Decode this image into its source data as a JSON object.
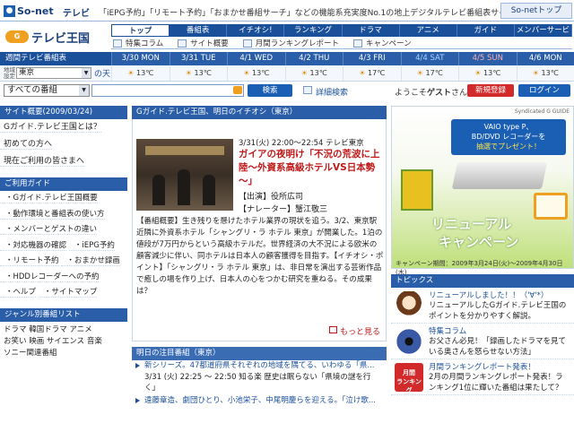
{
  "topbar": {
    "logo": "So-net",
    "tv": "テレビ",
    "tagline": "「iEPG予約」「リモート予約」「おまかせ番組サーチ」などの機能系充実度No.1の地上デジタルテレビ番組表サイト",
    "sonet_link": "So-netトップ"
  },
  "brand": {
    "badge": "G",
    "name": "テレビ王国"
  },
  "nav": {
    "tabs": [
      "トップ",
      "番組表",
      "イチオシ!",
      "ランキング",
      "ドラマ",
      "アニメ",
      "ガイド",
      "メンバーサービス"
    ],
    "active": 0,
    "sub": [
      "特集コラム",
      "サイト概要",
      "月間ランキングレポート",
      "キャンペーン"
    ]
  },
  "weekbar": {
    "label": "週間テレビ番組表",
    "days": [
      {
        "date": "3/30",
        "dow": "MON"
      },
      {
        "date": "3/31",
        "dow": "TUE"
      },
      {
        "date": "4/1",
        "dow": "WED"
      },
      {
        "date": "4/2",
        "dow": "THU"
      },
      {
        "date": "4/3",
        "dow": "FRI"
      },
      {
        "date": "4/4",
        "dow": "SAT"
      },
      {
        "date": "4/5",
        "dow": "SUN"
      },
      {
        "date": "4/6",
        "dow": "MON"
      }
    ]
  },
  "weather": {
    "label": "地域設定",
    "region": "東京",
    "suffix": "の天",
    "temps": [
      "13℃",
      "13℃",
      "13℃",
      "13℃",
      "17℃",
      "17℃",
      "13℃",
      "13℃"
    ]
  },
  "search": {
    "category": "すべての番組",
    "button": "検索",
    "advanced": "詳細検索",
    "welcome_pre": "ようこそ",
    "welcome_user": "ゲスト",
    "welcome_post": "さん",
    "register": "新規登録",
    "login": "ログイン"
  },
  "left": {
    "overview_head": "サイト概要(2009/03/24)",
    "overview_items": [
      "Gガイド.テレビ王国とは？",
      "初めての方へ",
      "現在ご利用の皆さまへ"
    ],
    "guide_head": "ご利用ガイド",
    "guide_items": [
      "・Gガイド.テレビ王国概要",
      "・動作環境と番組表の使い方",
      "・メンバーとゲストの違い",
      "・対応機器の確認",
      "・iEPG予約",
      "・リモート予約",
      "・おまかせ録画",
      "・HDDレコーダーへの予約",
      "・ヘルプ",
      "・サイトマップ"
    ],
    "genre_head": "ジャンル別番組リスト",
    "genre_line1": "ドラマ 韓国ドラマ アニメ",
    "genre_line2": "お笑い 映画 サイエンス 音楽",
    "genre_line3": "ソニー関連番組"
  },
  "center": {
    "feature_head": "Gガイド.テレビ王国、明日のイチオシ（東京）",
    "time": "3/31(火) 22:00～22:54 テレビ東京",
    "title": "ガイアの夜明け「不況の荒波に上陸～外資系高級ホテルVS日本勢～」",
    "cast1": "【出演】役所広司",
    "cast2": "【ナレーター】蟹江敬三",
    "body": "【番組概要】生き残りを懸けたホテル業界の現状を追う。3/2、東京駅近隣に外資系ホテル「シャングリ・ラ ホテル 東京」が開業した。1泊の値段が7万円からという高級ホテルだ。世界経済の大不況による欧米の顧客減少に伴い、同ホテルは日本人の顧客獲得を目指す。【イチオシ・ポイント】「シャングリ・ラ ホテル 東京」は、非日常を演出する芸術作品で癒しの場を作り上げ、日本人の心をつかむ研究を重ねる。その成果は？",
    "more": "もっと見る",
    "notable_head": "明日の注目番組（東京）",
    "notable_1": "新シリーズ。47都道府県それぞれの地域を隅てる、いわゆる「県...",
    "notable_1_time": "3/31 (火) 22:25 ～ 22:50 知る楽 歴史は眠らない「県境の謎を行く」",
    "notable_2": "遠藤章造、劇団ひとり、小池栄子、中尾明慶らを迎える。「泣け歌..."
  },
  "right": {
    "syndicated": "Syndicated G GUIDE",
    "ad_line1": "VAIO type P、",
    "ad_line2": "BD/DVD レコーダーを",
    "ad_line3": "抽選でプレゼント！",
    "ad_title1": "リニューアル",
    "ad_title2": "キャンペーン",
    "ad_period": "キャンペーン期間：2009年3月24日(火)～2009年4月30日(木)",
    "topics_head": "トピックス",
    "topics": [
      {
        "title": "リニューアルしました！！（'∀'*）",
        "body": "リニューアルしたGガイド.テレビ王国のポイントを分かりやすく解説。"
      },
      {
        "title": "特集コラム",
        "body": "お父さん必見！「録画したドラマを見ている奥さんを怒らせない方法」"
      },
      {
        "title": "月間ランキングレポート発表！",
        "body": "2月の月間ランキングレポート発表！ランキング1位に輝いた番組は果たして？"
      }
    ]
  }
}
